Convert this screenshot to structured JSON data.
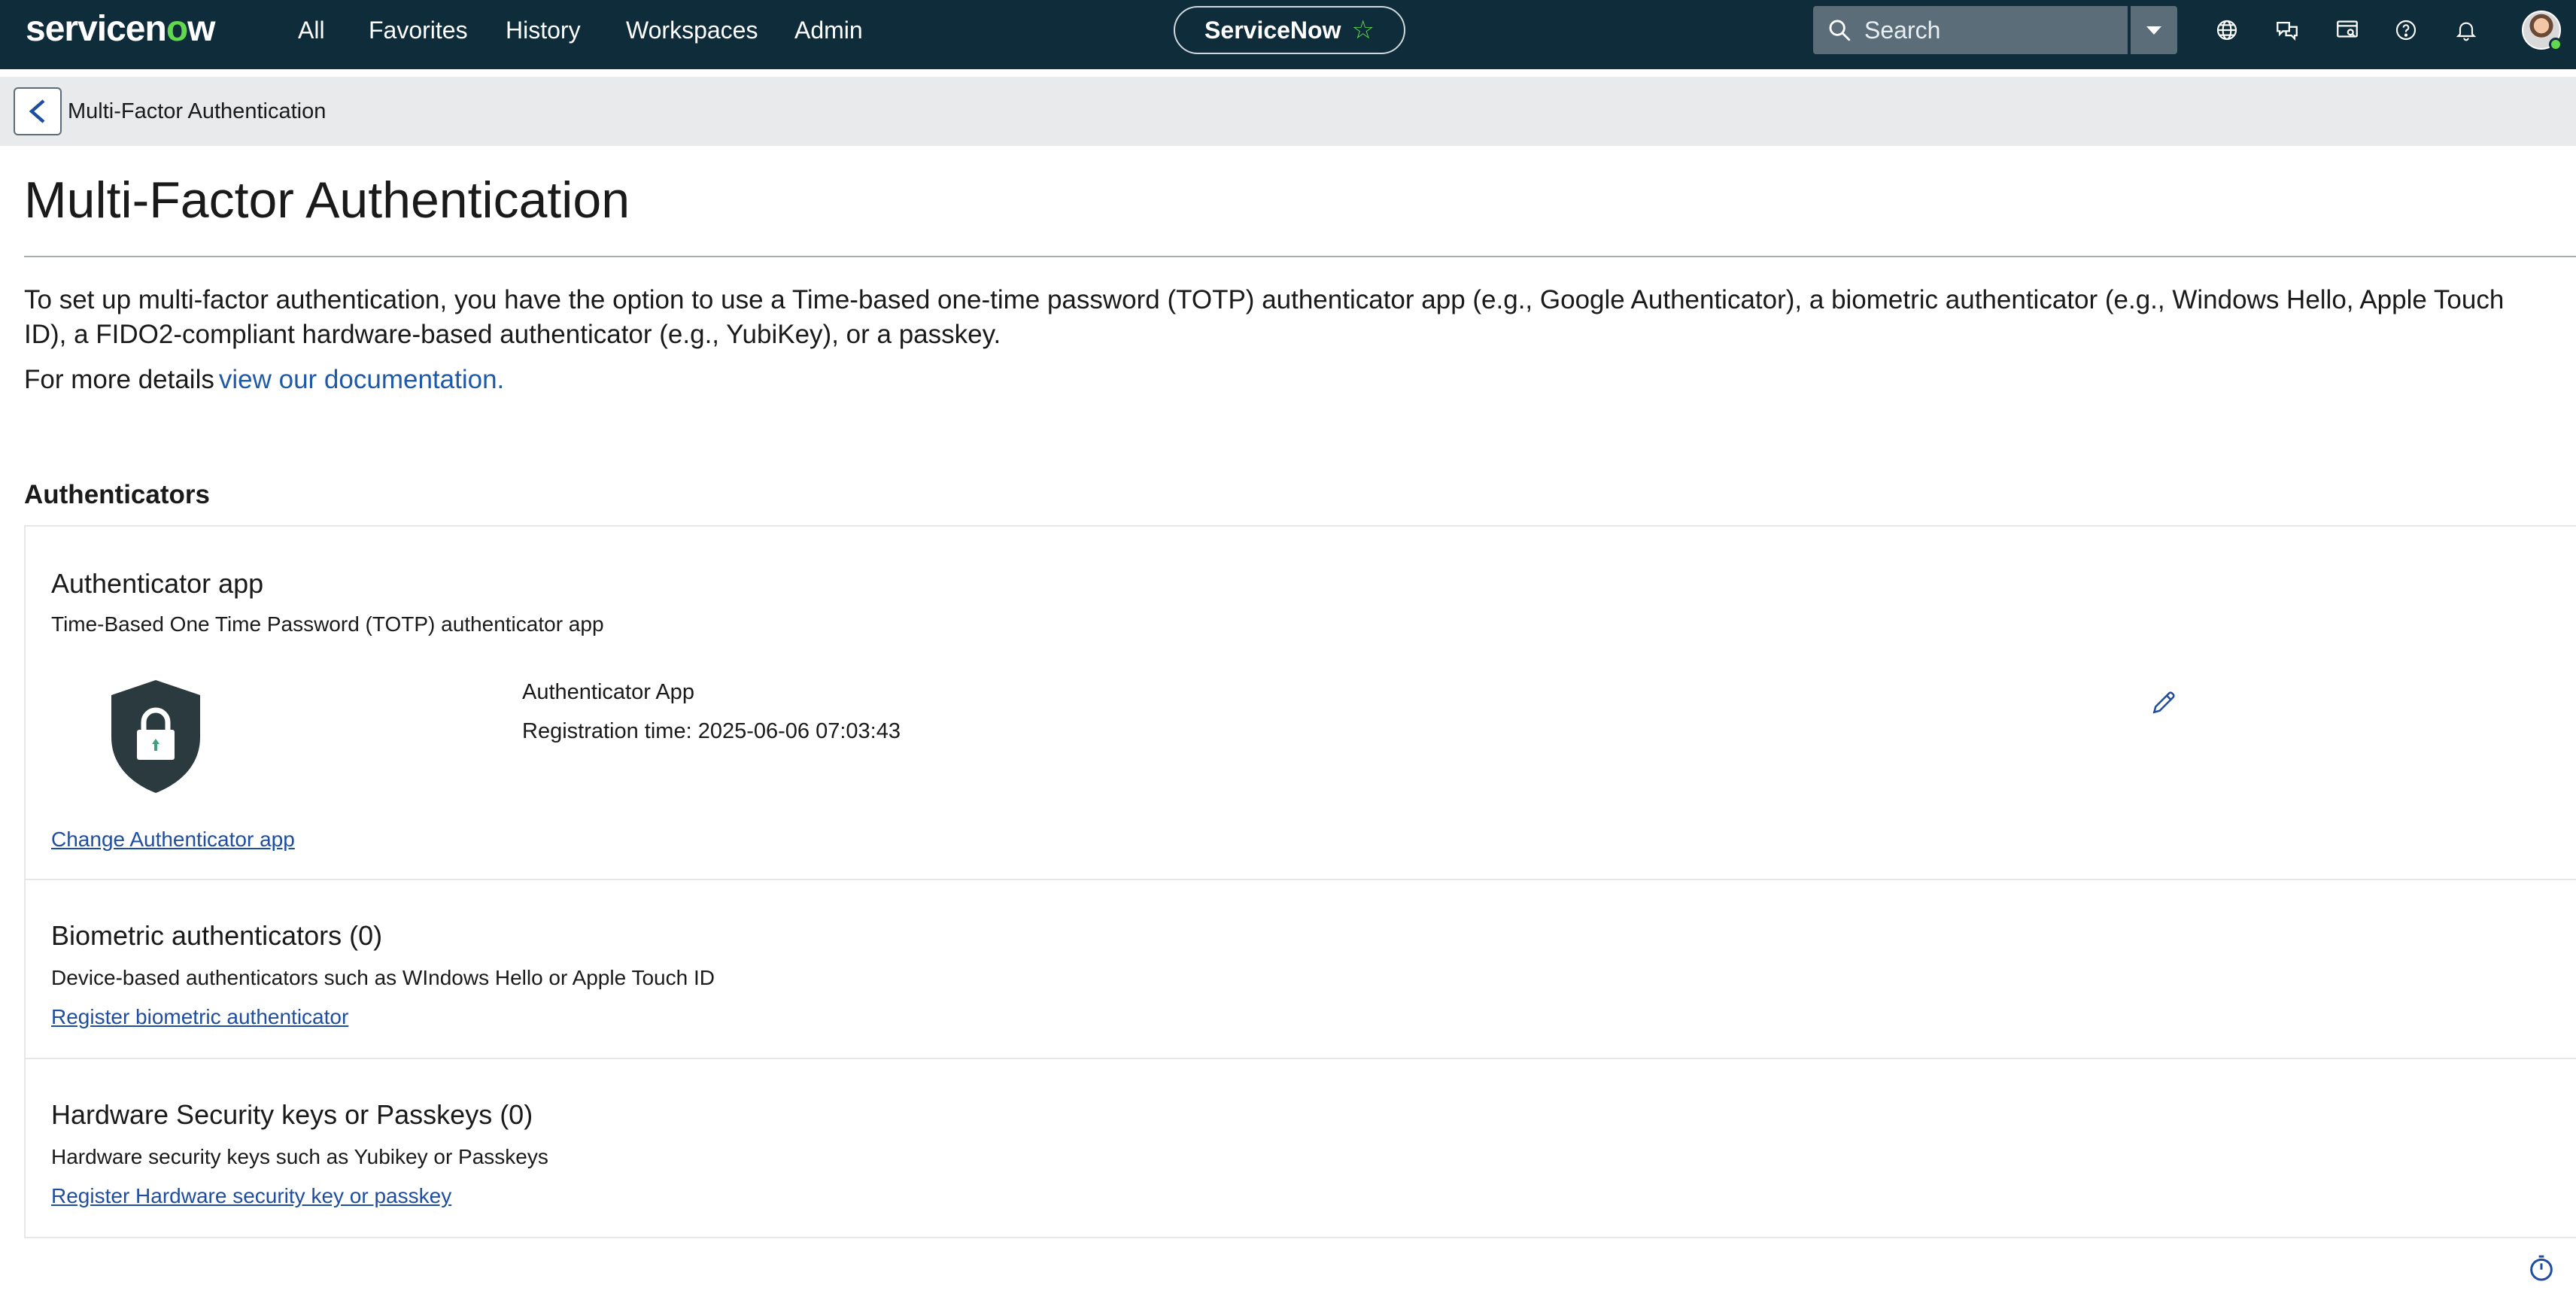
{
  "brand": {
    "logo_text_a": "servicen",
    "logo_text_o": "o",
    "logo_text_b": "w"
  },
  "nav": {
    "items": [
      {
        "label": "All"
      },
      {
        "label": "Favorites"
      },
      {
        "label": "History"
      },
      {
        "label": "Workspaces"
      },
      {
        "label": "Admin"
      }
    ],
    "center_pill": "ServiceNow",
    "search": {
      "placeholder": "Search"
    }
  },
  "breadcrumb": {
    "title": "Multi-Factor Authentication"
  },
  "page": {
    "title": "Multi-Factor Authentication",
    "intro": "To set up multi-factor authentication, you have the option to use a Time-based one-time password (TOTP) authenticator app (e.g., Google Authenticator), a biometric authenticator (e.g., Windows Hello, Apple Touch ID), a FIDO2-compliant hardware-based authenticator (e.g., YubiKey), or a passkey.",
    "more_prefix": "For more details",
    "more_link": "view our documentation.",
    "section_heading": "Authenticators"
  },
  "authenticators": {
    "app": {
      "title": "Authenticator app",
      "subtitle": "Time-Based One Time Password (TOTP) authenticator app",
      "device_name": "Authenticator App",
      "registration": "Registration time: 2025-06-06 07:03:43",
      "link": "Change Authenticator app"
    },
    "biometric": {
      "title": "Biometric authenticators (0)",
      "subtitle": "Device-based authenticators such as WIndows Hello or Apple Touch ID",
      "link": "Register biometric authenticator"
    },
    "hardware": {
      "title": "Hardware Security keys or Passkeys (0)",
      "subtitle": "Hardware security keys such as Yubikey or Passkeys",
      "link": "Register Hardware security key or passkey"
    }
  },
  "colors": {
    "nav_bg": "#0f2c3b",
    "brand_green": "#62d84e",
    "link": "#1f4ea0",
    "shield": "#2b3a3f"
  }
}
